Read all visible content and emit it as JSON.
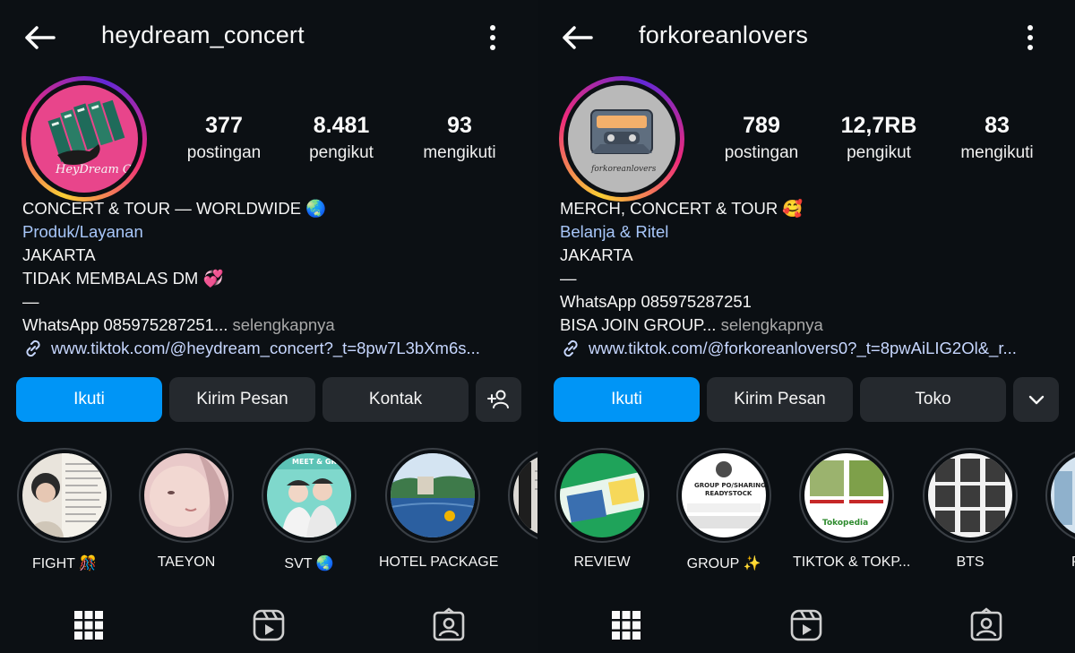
{
  "screens": [
    {
      "username": "heydream_concert",
      "stats": [
        {
          "num": "377",
          "label": "postingan"
        },
        {
          "num": "8.481",
          "label": "pengikut"
        },
        {
          "num": "93",
          "label": "mengikuti"
        }
      ],
      "bio": {
        "line1": "CONCERT & TOUR — WORLDWIDE 🌏",
        "category": "Produk/Layanan",
        "line3": "JAKARTA",
        "line4": "TIDAK MEMBALAS DM 💞",
        "line5": "—",
        "line6_main": "WhatsApp 085975287251...",
        "more": " selengkapnya",
        "link": "www.tiktok.com/@heydream_concert?_t=8pw7L3bXm6s..."
      },
      "buttons": {
        "follow": "Ikuti",
        "message": "Kirim Pesan",
        "third": "Kontak"
      },
      "highlights": [
        "FIGHT 🎊",
        "TAEYON",
        "SVT 🌏",
        "HOTEL PACKAGE"
      ]
    },
    {
      "username": "forkoreanlovers",
      "stats": [
        {
          "num": "789",
          "label": "postingan"
        },
        {
          "num": "12,7RB",
          "label": "pengikut"
        },
        {
          "num": "83",
          "label": "mengikuti"
        }
      ],
      "bio": {
        "line1": "MERCH, CONCERT & TOUR 🥰",
        "category": "Belanja & Ritel",
        "line3": "JAKARTA",
        "line4": "—",
        "line5": "WhatsApp 085975287251",
        "line6_main": "BISA JOIN GROUP...",
        "more": " selengkapnya",
        "link": "www.tiktok.com/@forkoreanlovers0?_t=8pwAiLIG2Ol&_r..."
      },
      "buttons": {
        "follow": "Ikuti",
        "message": "Kirim Pesan",
        "third": "Toko"
      },
      "highlights": [
        "REVIEW",
        "GROUP ✨",
        "TIKTOK & TOKP...",
        "BTS",
        "PO &"
      ]
    }
  ],
  "icons": {
    "back": "arrow-left-icon",
    "more": "kebab-icon",
    "add_user": "add-person-icon",
    "dropdown": "chevron-down-icon",
    "grid": "grid-icon",
    "reels": "reels-icon",
    "tagged": "tagged-icon",
    "link": "link-icon"
  },
  "colors": {
    "background": "#0c1014",
    "primary_button": "#0095f6",
    "secondary_button": "#25292e",
    "category_link": "#a8c7fa"
  }
}
